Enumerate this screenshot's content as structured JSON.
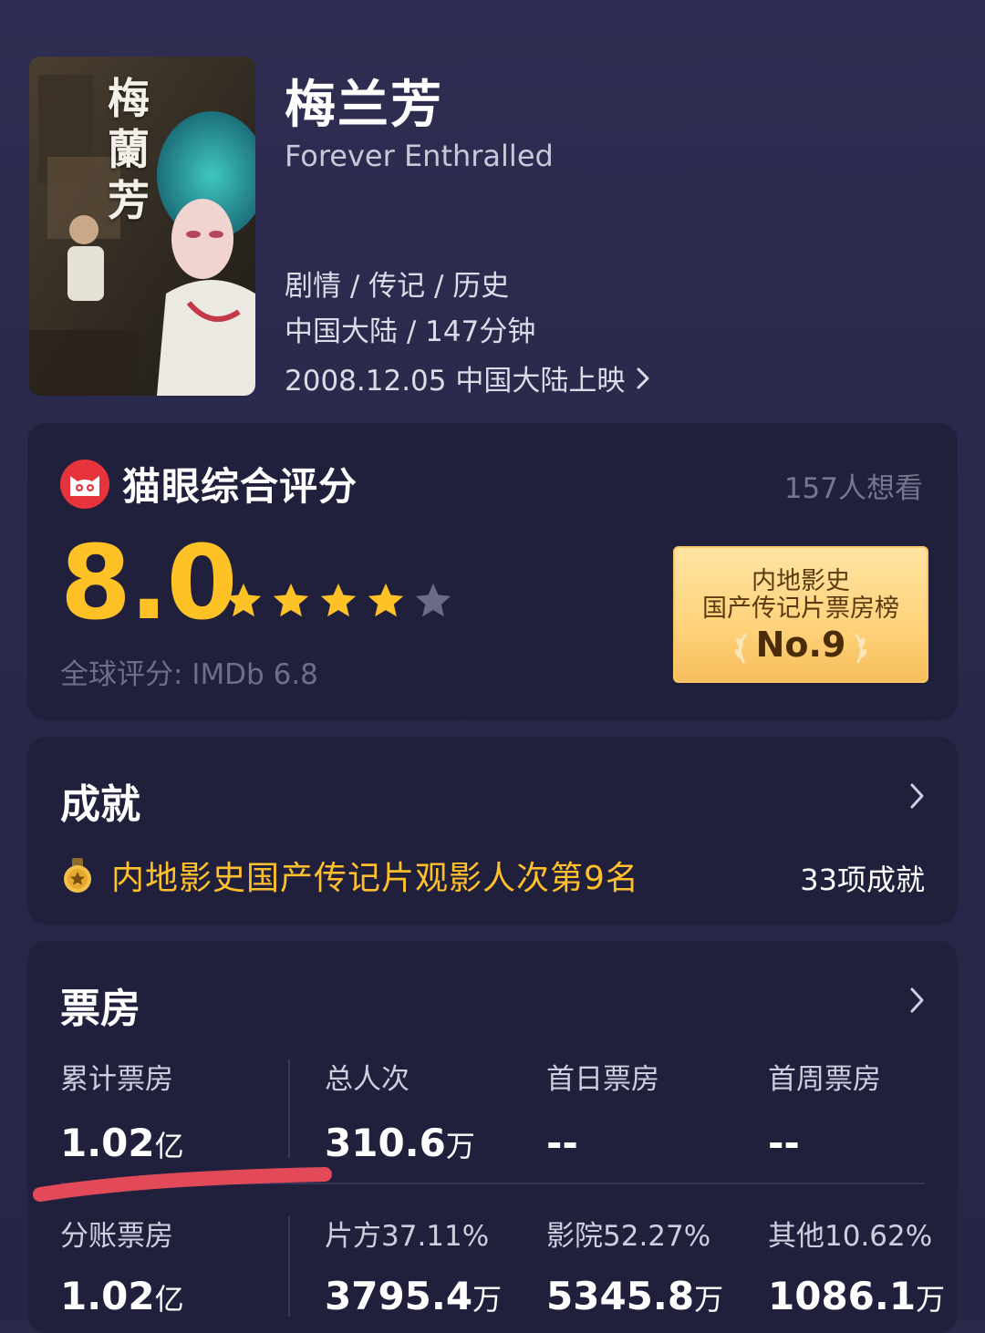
{
  "movie": {
    "title": "梅兰芳",
    "title_en": "Forever Enthralled",
    "genre": "剧情 / 传记 / 历史",
    "region_duration": "中国大陆 / 147分钟",
    "release": "2008.12.05 中国大陆上映",
    "poster_calligraphy": "梅蘭芳"
  },
  "rating": {
    "title": "猫眼综合评分",
    "want_count": "157人想看",
    "score": "8.0",
    "stars": 4,
    "stars_max": 5,
    "imdb": "全球评分: IMDb 6.8",
    "rank_line1": "内地影史",
    "rank_line2": "国产传记片票房榜",
    "rank_no": "No.9"
  },
  "achievements": {
    "title": "成就",
    "highlight": "内地影史国产传记片观影人次第9名",
    "count": "33项成就"
  },
  "box_office": {
    "title": "票房",
    "row1": [
      {
        "label": "累计票房",
        "value": "1.02",
        "unit": "亿"
      },
      {
        "label": "总人次",
        "value": "310.6",
        "unit": "万"
      },
      {
        "label": "首日票房",
        "value": "--",
        "unit": ""
      },
      {
        "label": "首周票房",
        "value": "--",
        "unit": ""
      }
    ],
    "row2": [
      {
        "label": "分账票房",
        "value": "1.02",
        "unit": "亿"
      },
      {
        "label": "片方37.11%",
        "value": "3795.4",
        "unit": "万"
      },
      {
        "label": "影院52.27%",
        "value": "5345.8",
        "unit": "万"
      },
      {
        "label": "其他10.62%",
        "value": "1086.1",
        "unit": "万"
      }
    ]
  },
  "colors": {
    "background": "#2b2a4a",
    "card": "#20203d",
    "score": "#ffc226",
    "achievement": "#ffc02b",
    "maoyan_red": "#e7333b",
    "annotation_red": "#e24a5a"
  }
}
